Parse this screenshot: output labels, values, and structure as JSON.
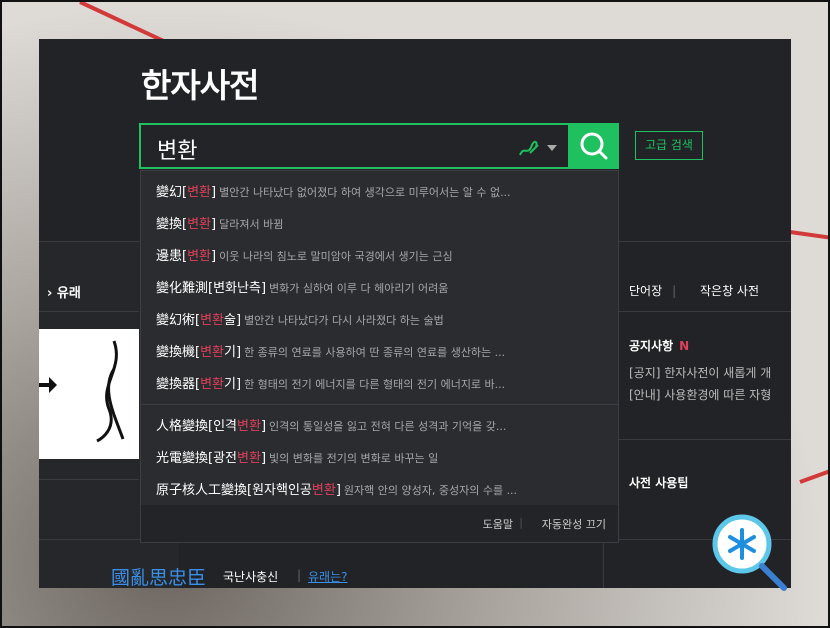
{
  "page": {
    "title": "한자사전"
  },
  "search": {
    "value": "변환",
    "advanced_label": "고급 검색"
  },
  "suggestions": [
    {
      "hanja": "變幻",
      "open": "[",
      "pre": "",
      "hl": "변환",
      "post": "",
      "close": "]",
      "desc": "별안간 나타났다 없어졌다 하여 생각으로 미루어서는 알 수 없..."
    },
    {
      "hanja": "變換",
      "open": "[",
      "pre": "",
      "hl": "변환",
      "post": "",
      "close": "]",
      "desc": "달라져서 바뀜"
    },
    {
      "hanja": "邊患",
      "open": "[",
      "pre": "",
      "hl": "변환",
      "post": "",
      "close": "]",
      "desc": "이웃 나라의 침노로 말미암아 국경에서 생기는 근심"
    },
    {
      "hanja": "變化難測",
      "open": "[",
      "pre": "변화난측",
      "hl": "",
      "post": "",
      "close": "]",
      "desc": "변화가 심하여 이루 다 헤아리기 어려움"
    },
    {
      "hanja": "變幻術",
      "open": "[",
      "pre": "",
      "hl": "변환",
      "post": "술",
      "close": "]",
      "desc": "별안간 나타났다가 다시 사라졌다 하는 술법"
    },
    {
      "hanja": "變換機",
      "open": "[",
      "pre": "",
      "hl": "변환",
      "post": "기",
      "close": "]",
      "desc": "한 종류의 연료를 사용하여 딴 종류의 연료를 생산하는 ..."
    },
    {
      "hanja": "變換器",
      "open": "[",
      "pre": "",
      "hl": "변환",
      "post": "기",
      "close": "]",
      "desc": "한 형태의 전기 에너지를 다른 형태의 전기 에너지로 바..."
    },
    {
      "hanja": "人格變換",
      "open": "[",
      "pre": "인격",
      "hl": "변환",
      "post": "",
      "close": "]",
      "desc": "인격의 통일성을 잃고 전혀 다른 성격과 기억을 갖..."
    },
    {
      "hanja": "光電變換",
      "open": "[",
      "pre": "광전",
      "hl": "변환",
      "post": "",
      "close": "]",
      "desc": "빛의 변화를 전기의 변화로 바꾸는 일"
    },
    {
      "hanja": "原子核人工變換",
      "open": "[",
      "pre": "원자핵인공",
      "hl": "변환",
      "post": "",
      "close": "]",
      "desc": "원자핵 안의 양성자, 중성자의 수를 ..."
    }
  ],
  "dropdown_footer": {
    "help": "도움말",
    "autocomplete_off": "자동완성 끄기"
  },
  "left": {
    "origin_label": "유래"
  },
  "right": {
    "links": [
      "단어장",
      "작은창 사전"
    ],
    "notice_title": "공지사항",
    "notice_badge": "N",
    "notices": [
      "[공지] 한자사전이 새롭게 개",
      "[안내] 사용환경에 따른 자형"
    ],
    "tips_title": "사전 사용팁"
  },
  "bottom": {
    "hanja": "國亂思忠臣",
    "hangul": "국난사충신",
    "link": "유래는?"
  },
  "colors": {
    "accent": "#1ec05f",
    "highlight": "#e0415a",
    "link": "#3a8fe8",
    "panel_bg": "#222327"
  },
  "icons": {
    "search": "search-icon",
    "handwriting": "handwriting-icon",
    "assistant": "magnifier-asterisk-icon"
  }
}
